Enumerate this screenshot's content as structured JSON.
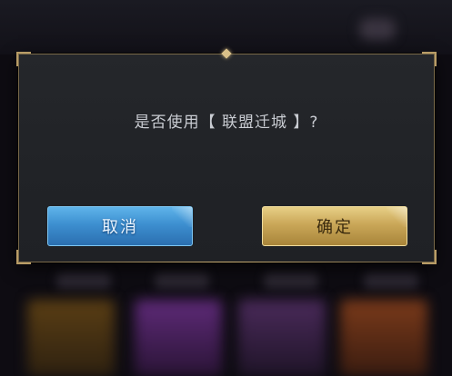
{
  "dialog": {
    "message": "是否使用【 联盟迁城 】?",
    "cancel_label": "取消",
    "confirm_label": "确定"
  },
  "colors": {
    "dialog_bg": "#232529",
    "frame_gold": "#b89c66",
    "cancel_blue": "#3d8fd0",
    "confirm_gold": "#caa758",
    "message_text": "#c9ccd2"
  }
}
